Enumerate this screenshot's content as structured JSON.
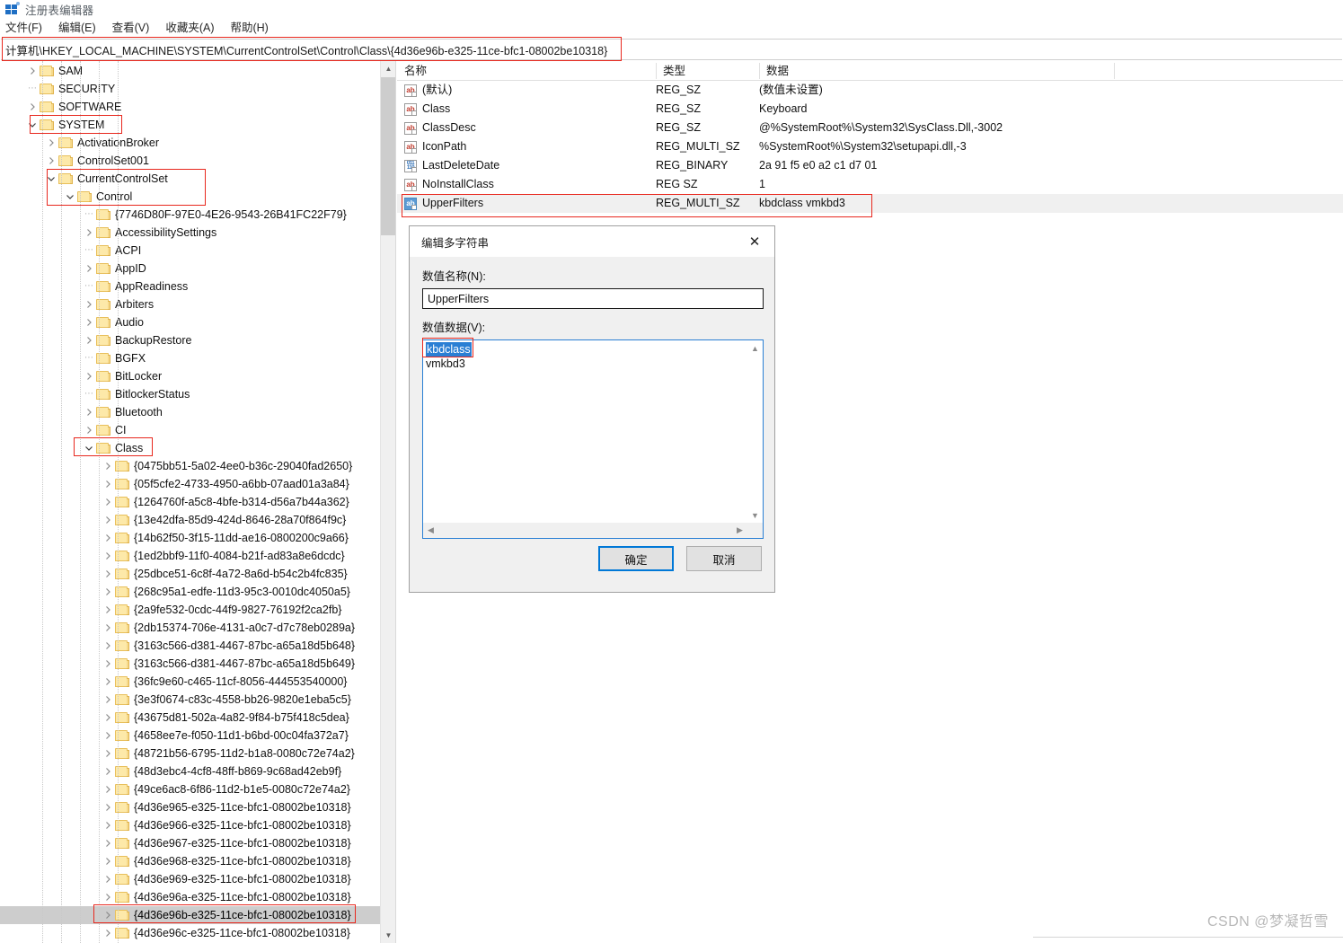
{
  "window": {
    "title": "注册表编辑器",
    "icon": "registry-editor-icon"
  },
  "menubar": {
    "items": [
      {
        "label": "文件(F)",
        "name": "menu-file"
      },
      {
        "label": "编辑(E)",
        "name": "menu-edit"
      },
      {
        "label": "查看(V)",
        "name": "menu-view"
      },
      {
        "label": "收藏夹(A)",
        "name": "menu-favorites"
      },
      {
        "label": "帮助(H)",
        "name": "menu-help"
      }
    ]
  },
  "address": {
    "value": "计算机\\HKEY_LOCAL_MACHINE\\SYSTEM\\CurrentControlSet\\Control\\Class\\{4d36e96b-e325-11ce-bfc1-08002be10318}"
  },
  "tree": {
    "nodes": [
      {
        "label": "SAM",
        "depth": 1,
        "state": "collapsed",
        "selected": false,
        "annotated": false
      },
      {
        "label": "SECURITY",
        "depth": 1,
        "state": "leaf",
        "selected": false,
        "annotated": false
      },
      {
        "label": "SOFTWARE",
        "depth": 1,
        "state": "collapsed",
        "selected": false,
        "annotated": false
      },
      {
        "label": "SYSTEM",
        "depth": 1,
        "state": "expanded",
        "selected": false,
        "annotated": true
      },
      {
        "label": "ActivationBroker",
        "depth": 2,
        "state": "collapsed",
        "selected": false,
        "annotated": false
      },
      {
        "label": "ControlSet001",
        "depth": 2,
        "state": "collapsed",
        "selected": false,
        "annotated": false
      },
      {
        "label": "CurrentControlSet",
        "depth": 2,
        "state": "expanded",
        "selected": false,
        "annotated": true
      },
      {
        "label": "Control",
        "depth": 3,
        "state": "expanded",
        "selected": false,
        "annotated": true
      },
      {
        "label": "{7746D80F-97E0-4E26-9543-26B41FC22F79}",
        "depth": 4,
        "state": "leaf",
        "selected": false,
        "annotated": false
      },
      {
        "label": "AccessibilitySettings",
        "depth": 4,
        "state": "collapsed",
        "selected": false,
        "annotated": false
      },
      {
        "label": "ACPI",
        "depth": 4,
        "state": "leaf",
        "selected": false,
        "annotated": false
      },
      {
        "label": "AppID",
        "depth": 4,
        "state": "collapsed",
        "selected": false,
        "annotated": false
      },
      {
        "label": "AppReadiness",
        "depth": 4,
        "state": "leaf",
        "selected": false,
        "annotated": false
      },
      {
        "label": "Arbiters",
        "depth": 4,
        "state": "collapsed",
        "selected": false,
        "annotated": false
      },
      {
        "label": "Audio",
        "depth": 4,
        "state": "collapsed",
        "selected": false,
        "annotated": false
      },
      {
        "label": "BackupRestore",
        "depth": 4,
        "state": "collapsed",
        "selected": false,
        "annotated": false
      },
      {
        "label": "BGFX",
        "depth": 4,
        "state": "leaf",
        "selected": false,
        "annotated": false
      },
      {
        "label": "BitLocker",
        "depth": 4,
        "state": "collapsed",
        "selected": false,
        "annotated": false
      },
      {
        "label": "BitlockerStatus",
        "depth": 4,
        "state": "leaf",
        "selected": false,
        "annotated": false
      },
      {
        "label": "Bluetooth",
        "depth": 4,
        "state": "collapsed",
        "selected": false,
        "annotated": false
      },
      {
        "label": "CI",
        "depth": 4,
        "state": "collapsed",
        "selected": false,
        "annotated": false
      },
      {
        "label": "Class",
        "depth": 4,
        "state": "expanded",
        "selected": false,
        "annotated": true
      },
      {
        "label": "{0475bb51-5a02-4ee0-b36c-29040fad2650}",
        "depth": 5,
        "state": "collapsed",
        "selected": false,
        "annotated": false
      },
      {
        "label": "{05f5cfe2-4733-4950-a6bb-07aad01a3a84}",
        "depth": 5,
        "state": "collapsed",
        "selected": false,
        "annotated": false
      },
      {
        "label": "{1264760f-a5c8-4bfe-b314-d56a7b44a362}",
        "depth": 5,
        "state": "collapsed",
        "selected": false,
        "annotated": false
      },
      {
        "label": "{13e42dfa-85d9-424d-8646-28a70f864f9c}",
        "depth": 5,
        "state": "collapsed",
        "selected": false,
        "annotated": false
      },
      {
        "label": "{14b62f50-3f15-11dd-ae16-0800200c9a66}",
        "depth": 5,
        "state": "collapsed",
        "selected": false,
        "annotated": false
      },
      {
        "label": "{1ed2bbf9-11f0-4084-b21f-ad83a8e6dcdc}",
        "depth": 5,
        "state": "collapsed",
        "selected": false,
        "annotated": false
      },
      {
        "label": "{25dbce51-6c8f-4a72-8a6d-b54c2b4fc835}",
        "depth": 5,
        "state": "collapsed",
        "selected": false,
        "annotated": false
      },
      {
        "label": "{268c95a1-edfe-11d3-95c3-0010dc4050a5}",
        "depth": 5,
        "state": "collapsed",
        "selected": false,
        "annotated": false
      },
      {
        "label": "{2a9fe532-0cdc-44f9-9827-76192f2ca2fb}",
        "depth": 5,
        "state": "collapsed",
        "selected": false,
        "annotated": false
      },
      {
        "label": "{2db15374-706e-4131-a0c7-d7c78eb0289a}",
        "depth": 5,
        "state": "collapsed",
        "selected": false,
        "annotated": false
      },
      {
        "label": "{3163c566-d381-4467-87bc-a65a18d5b648}",
        "depth": 5,
        "state": "collapsed",
        "selected": false,
        "annotated": false
      },
      {
        "label": "{3163c566-d381-4467-87bc-a65a18d5b649}",
        "depth": 5,
        "state": "collapsed",
        "selected": false,
        "annotated": false
      },
      {
        "label": "{36fc9e60-c465-11cf-8056-444553540000}",
        "depth": 5,
        "state": "collapsed",
        "selected": false,
        "annotated": false
      },
      {
        "label": "{3e3f0674-c83c-4558-bb26-9820e1eba5c5}",
        "depth": 5,
        "state": "collapsed",
        "selected": false,
        "annotated": false
      },
      {
        "label": "{43675d81-502a-4a82-9f84-b75f418c5dea}",
        "depth": 5,
        "state": "collapsed",
        "selected": false,
        "annotated": false
      },
      {
        "label": "{4658ee7e-f050-11d1-b6bd-00c04fa372a7}",
        "depth": 5,
        "state": "collapsed",
        "selected": false,
        "annotated": false
      },
      {
        "label": "{48721b56-6795-11d2-b1a8-0080c72e74a2}",
        "depth": 5,
        "state": "collapsed",
        "selected": false,
        "annotated": false
      },
      {
        "label": "{48d3ebc4-4cf8-48ff-b869-9c68ad42eb9f}",
        "depth": 5,
        "state": "collapsed",
        "selected": false,
        "annotated": false
      },
      {
        "label": "{49ce6ac8-6f86-11d2-b1e5-0080c72e74a2}",
        "depth": 5,
        "state": "collapsed",
        "selected": false,
        "annotated": false
      },
      {
        "label": "{4d36e965-e325-11ce-bfc1-08002be10318}",
        "depth": 5,
        "state": "collapsed",
        "selected": false,
        "annotated": false
      },
      {
        "label": "{4d36e966-e325-11ce-bfc1-08002be10318}",
        "depth": 5,
        "state": "collapsed",
        "selected": false,
        "annotated": false
      },
      {
        "label": "{4d36e967-e325-11ce-bfc1-08002be10318}",
        "depth": 5,
        "state": "collapsed",
        "selected": false,
        "annotated": false
      },
      {
        "label": "{4d36e968-e325-11ce-bfc1-08002be10318}",
        "depth": 5,
        "state": "collapsed",
        "selected": false,
        "annotated": false
      },
      {
        "label": "{4d36e969-e325-11ce-bfc1-08002be10318}",
        "depth": 5,
        "state": "collapsed",
        "selected": false,
        "annotated": false
      },
      {
        "label": "{4d36e96a-e325-11ce-bfc1-08002be10318}",
        "depth": 5,
        "state": "collapsed",
        "selected": false,
        "annotated": false
      },
      {
        "label": "{4d36e96b-e325-11ce-bfc1-08002be10318}",
        "depth": 5,
        "state": "collapsed",
        "selected": true,
        "annotated": true
      },
      {
        "label": "{4d36e96c-e325-11ce-bfc1-08002be10318}",
        "depth": 5,
        "state": "collapsed",
        "selected": false,
        "annotated": false
      }
    ]
  },
  "values": {
    "columns": [
      "名称",
      "类型",
      "数据"
    ],
    "rows": [
      {
        "name": "(默认)",
        "type": "REG_SZ",
        "data": "(数值未设置)",
        "icon": "string-value-icon",
        "selected": false
      },
      {
        "name": "Class",
        "type": "REG_SZ",
        "data": "Keyboard",
        "icon": "string-value-icon",
        "selected": false
      },
      {
        "name": "ClassDesc",
        "type": "REG_SZ",
        "data": "@%SystemRoot%\\System32\\SysClass.Dll,-3002",
        "icon": "string-value-icon",
        "selected": false
      },
      {
        "name": "IconPath",
        "type": "REG_MULTI_SZ",
        "data": "%SystemRoot%\\System32\\setupapi.dll,-3",
        "icon": "string-value-icon",
        "selected": false
      },
      {
        "name": "LastDeleteDate",
        "type": "REG_BINARY",
        "data": "2a 91 f5 e0 a2 c1 d7 01",
        "icon": "binary-value-icon",
        "selected": false
      },
      {
        "name": "NoInstallClass",
        "type": "REG SZ",
        "data": "1",
        "icon": "string-value-icon",
        "selected": false
      },
      {
        "name": "UpperFilters",
        "type": "REG_MULTI_SZ",
        "data": "kbdclass vmkbd3",
        "icon": "string-value-icon",
        "selected": true
      }
    ]
  },
  "dialog": {
    "title": "编辑多字符串",
    "close_label": "✕",
    "name_label": "数值名称(N):",
    "name_value": "UpperFilters",
    "data_label": "数值数据(V):",
    "data_lines": [
      "kbdclass",
      "vmkbd3"
    ],
    "selected_line": "kbdclass",
    "ok_label": "确定",
    "cancel_label": "取消"
  },
  "watermark": {
    "text": "CSDN @梦凝哲雪"
  },
  "colors": {
    "annotation": "#e8281e",
    "selection": "#2a7fd4",
    "accent": "#0078d7"
  }
}
